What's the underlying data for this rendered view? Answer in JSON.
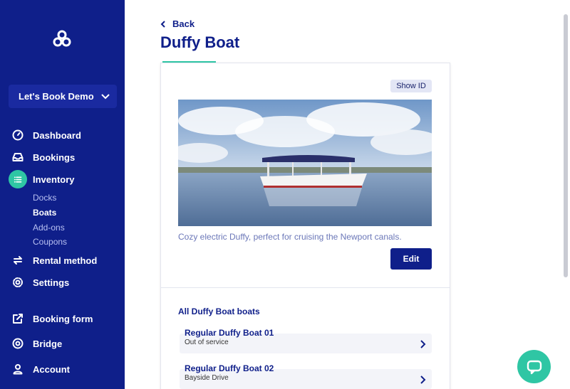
{
  "sidebar": {
    "org_selector": "Let's Book Demo",
    "items": [
      {
        "label": "Dashboard",
        "icon": "dashboard-gauge-icon"
      },
      {
        "label": "Bookings",
        "icon": "inbox-icon"
      },
      {
        "label": "Inventory",
        "icon": "list-icon",
        "active": true
      },
      {
        "label": "Rental method",
        "icon": "swap-arrows-icon"
      },
      {
        "label": "Settings",
        "icon": "gear-icon"
      },
      {
        "label": "Booking form",
        "icon": "external-link-icon"
      },
      {
        "label": "Bridge",
        "icon": "globe-icon"
      },
      {
        "label": "Account",
        "icon": "user-icon"
      }
    ],
    "inventory_subitems": [
      "Docks",
      "Boats",
      "Add-ons",
      "Coupons"
    ],
    "active_subitem": "Boats"
  },
  "main": {
    "back_label": "Back",
    "title": "Duffy Boat",
    "show_id_label": "Show ID",
    "description": "Cozy electric Duffy, perfect for cruising the Newport canals.",
    "edit_label": "Edit",
    "section_title": "All Duffy Boat boats",
    "boats": [
      {
        "name": "Regular Duffy Boat 01",
        "status": "Out of service"
      },
      {
        "name": "Regular Duffy Boat 02",
        "status": "Bayside Drive"
      }
    ]
  },
  "colors": {
    "sidebar_bg": "#0f1f8a",
    "accent": "#2fc6a4",
    "primary": "#0f1f8a"
  }
}
